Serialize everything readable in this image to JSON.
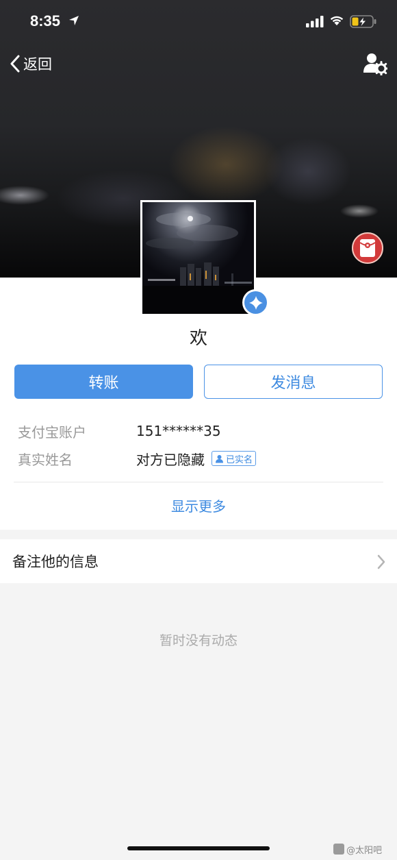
{
  "status_bar": {
    "time": "8:35"
  },
  "nav": {
    "back_label": "返回"
  },
  "profile": {
    "nickname": "欢",
    "buttons": {
      "transfer": "转账",
      "message": "发消息"
    },
    "info": [
      {
        "label": "支付宝账户",
        "value": "151******35"
      },
      {
        "label": "真实姓名",
        "value": "对方已隐藏",
        "tag": "已实名"
      }
    ],
    "show_more": "显示更多"
  },
  "remark": {
    "label": "备注他的信息"
  },
  "feed": {
    "empty": "暂时没有动态"
  },
  "colors": {
    "accent": "#4a92e6",
    "red_packet": "#d23a3a",
    "background": "#f4f4f4"
  },
  "icons": {
    "back": "chevron-left-icon",
    "settings": "user-settings-icon",
    "red_packet": "red-packet-icon",
    "badge": "verified-diamond-icon",
    "chevron": "chevron-right-icon"
  },
  "watermark": {
    "text": "@太阳吧"
  }
}
